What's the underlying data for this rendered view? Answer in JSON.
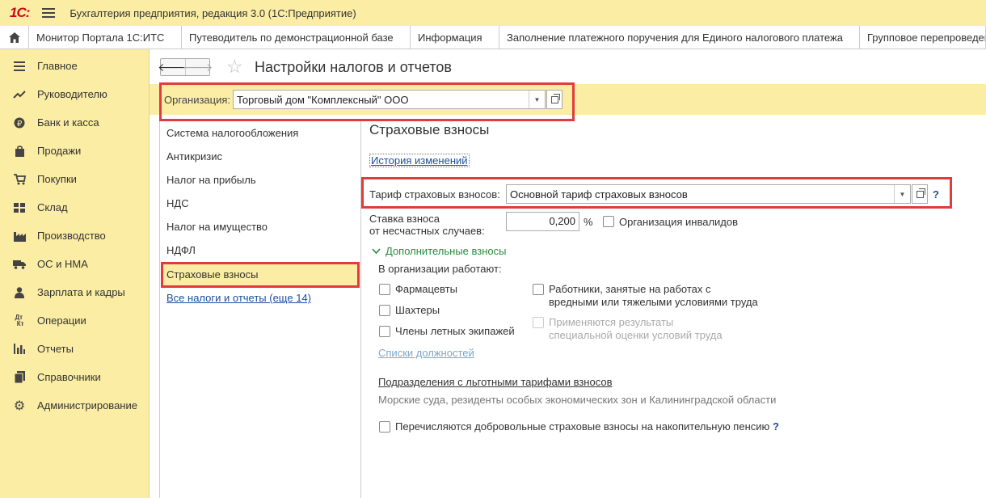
{
  "titlebar": {
    "logo": "1С:",
    "title": "Бухгалтерия предприятия, редакция 3.0  (1С:Предприятие)"
  },
  "tabs": [
    "Монитор Портала 1С:ИТС",
    "Путеводитель по демонстрационной базе",
    "Информация",
    "Заполнение платежного поручения для Единого налогового платежа",
    "Групповое перепроведение"
  ],
  "sidebar": {
    "items": [
      {
        "label": "Главное",
        "icon": "menu-lines-icon"
      },
      {
        "label": "Руководителю",
        "icon": "trend-icon"
      },
      {
        "label": "Банк и касса",
        "icon": "coin-icon"
      },
      {
        "label": "Продажи",
        "icon": "bag-icon"
      },
      {
        "label": "Покупки",
        "icon": "cart-icon"
      },
      {
        "label": "Склад",
        "icon": "warehouse-icon"
      },
      {
        "label": "Производство",
        "icon": "factory-icon"
      },
      {
        "label": "ОС и НМА",
        "icon": "truck-icon"
      },
      {
        "label": "Зарплата и кадры",
        "icon": "person-icon"
      },
      {
        "label": "Операции",
        "icon": "dt-kt-icon"
      },
      {
        "label": "Отчеты",
        "icon": "bar-chart-icon"
      },
      {
        "label": "Справочники",
        "icon": "book-icon"
      },
      {
        "label": "Администрирование",
        "icon": "gear-icon"
      }
    ]
  },
  "main": {
    "back": "🡐",
    "forward": "🡒",
    "title": "Настройки налогов и отчетов",
    "org_label": "Организация:",
    "org_value": "Торговый дом \"Комплексный\" ООО",
    "sections": [
      "Система налогообложения",
      "Антикризис",
      "Налог на прибыль",
      "НДС",
      "Налог на имущество",
      "НДФЛ",
      "Страховые взносы"
    ],
    "all_taxes_link": "Все налоги и отчеты (еще 14)",
    "panel": {
      "title": "Страховые взносы",
      "history_link": "История изменений",
      "tariff_label": "Тариф страховых взносов:",
      "tariff_value": "Основной тариф страховых взносов",
      "rate_label_1": "Ставка взноса",
      "rate_label_2": "от несчастных случаев:",
      "rate_value": "0,200",
      "percent": "%",
      "disabled_org": "Организация инвалидов",
      "additional": "Дополнительные взносы",
      "works_label": "В организации работают:",
      "pharmacists": "Фармацевты",
      "miners": "Шахтеры",
      "flight_crew": "Члены летных экипажей",
      "hazard_1": "Работники, занятые на работах с",
      "hazard_2": "вредными или тяжелыми условиями труда",
      "assess_1": "Применяются результаты",
      "assess_2": "специальной оценки условий труда",
      "positions_link": "Списки должностей",
      "divisions_link": "Подразделения с льготными тарифами взносов",
      "divisions_note": "Морские суда, резиденты особых экономических зон и Калининградской области",
      "voluntary": "Перечисляются добровольные страховые взносы на накопительную пенсию",
      "help": "?"
    }
  }
}
